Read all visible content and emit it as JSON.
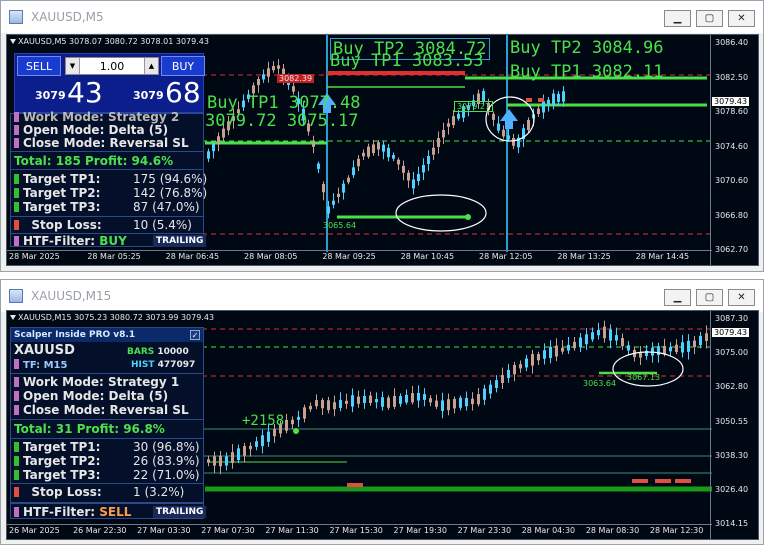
{
  "window1": {
    "title": "XAUUSD,M5",
    "ohlc_line": "XAUUSD,M5 3078.07 3080.72 3078.01 3079.43",
    "trade_panel": {
      "sell_label": "SELL",
      "buy_label": "BUY",
      "lot": "1.00",
      "bid_small": "3079",
      "bid_big": "43",
      "ask_small": "3079",
      "ask_big": "68"
    },
    "panel_rows": {
      "work_mode": "Work Mode: Strategy 2",
      "open_mode": "Open Mode: Delta (5)",
      "close_mode": "Close Mode: Reversal SL",
      "total": "Total: 185  Profit: 94.6%",
      "tp1": "Target TP1:",
      "tp1_val": "175 (94.6%)",
      "tp2": "Target TP2:",
      "tp2_val": "142 (76.8%)",
      "tp3": "Target TP3:",
      "tp3_val": "87 (47.0%)",
      "sl": "Stop Loss:",
      "sl_val": "10 (5.4%)",
      "htf": "HTF-Filter:",
      "htf_val": "BUY",
      "trailing": "TRAILING"
    },
    "annotations": {
      "buy_tp2_left": "Buy TP2 3084.72",
      "buy_tp1_left": "Buy TP1 3083.53",
      "buy_tp2_right": "Buy TP2 3084.96",
      "buy_tp1_right": "Buy TP1 3082.11",
      "buy_tp1_mid": "Buy TP1 3077.48",
      "buy_tp2_mid": "3079.72 3075.17",
      "level_3082": "3082.39",
      "level_3079": "3079.27",
      "level_3065": "3065.64"
    },
    "y_ticks": [
      "3086.40",
      "3082.50",
      "3078.60",
      "3074.60",
      "3070.60",
      "3066.80",
      "3062.70"
    ],
    "y_current": "3079.43",
    "x_ticks": [
      "28 Mar 2025",
      "28 Mar 05:25",
      "28 Mar 06:45",
      "28 Mar 08:05",
      "28 Mar 09:25",
      "28 Mar 10:45",
      "28 Mar 12:05",
      "28 Mar 13:25",
      "28 Mar 14:45"
    ],
    "colors": {
      "bull": "#4fd0ff",
      "bear": "#c8a090",
      "tp_line": "#4be04b",
      "sl_line": "#e03030",
      "vline": "#2aa0d0"
    }
  },
  "window2": {
    "title": "XAUUSD,M15",
    "ohlc_line": "XAUUSD,M15 3075.23 3080.72 3073.99 3079.43",
    "panel": {
      "header": "Scalper Inside PRO v8.1",
      "symbol": "XAUUSD",
      "tf": "TF: M15",
      "bars_label": "BARS",
      "bars_val": "10000",
      "hist_label": "HIST",
      "hist_val": "477097",
      "work_mode": "Work Mode: Strategy 1",
      "open_mode": "Open Mode: Delta (5)",
      "close_mode": "Close Mode: Reversal SL",
      "total": "Total: 31  Profit: 96.8%",
      "tp1": "Target TP1:",
      "tp1_val": "30 (96.8%)",
      "tp2": "Target TP2:",
      "tp2_val": "26 (83.9%)",
      "tp3": "Target TP3:",
      "tp3_val": "22 (71.0%)",
      "sl": "Stop Loss:",
      "sl_val": "1 (3.2%)",
      "htf": "HTF-Filter:",
      "htf_val": "SELL",
      "trailing": "TRAILING"
    },
    "annotations": {
      "profit": "+2158",
      "level_3063": "3063.64",
      "level_3067": "3067.13"
    },
    "y_ticks": [
      "3087.30",
      "3075.00",
      "3062.80",
      "3050.55",
      "3038.30",
      "3026.40",
      "3014.15"
    ],
    "y_current": "3079.43",
    "x_ticks": [
      "26 Mar 2025",
      "26 Mar 22:30",
      "27 Mar 03:30",
      "27 Mar 07:30",
      "27 Mar 11:30",
      "27 Mar 15:30",
      "27 Mar 19:30",
      "27 Mar 23:30",
      "28 Mar 04:30",
      "28 Mar 08:30",
      "28 Mar 12:30"
    ]
  }
}
